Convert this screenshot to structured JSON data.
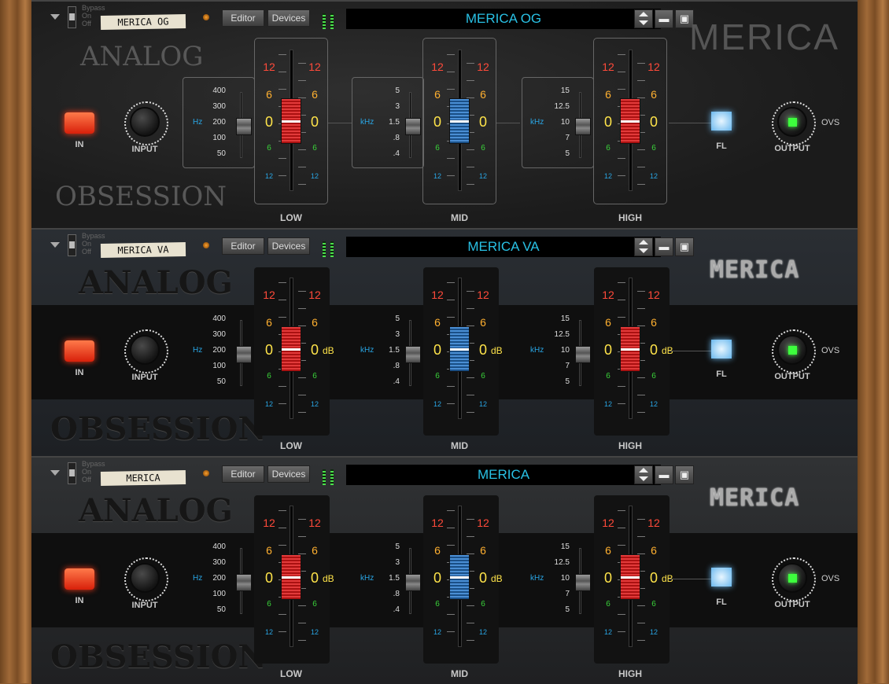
{
  "units": [
    {
      "style": "og",
      "header": {
        "bypass": "Bypass",
        "on": "On",
        "off": "Off",
        "name_label": "MERICA OG",
        "editor": "Editor",
        "devices": "Devices",
        "preset": "MERICA OG"
      },
      "brand": "MERICA",
      "deco_top": "ANALOG",
      "deco_bottom": "OBSESSION",
      "show_db": false,
      "boxed": true
    },
    {
      "style": "va",
      "header": {
        "bypass": "Bypass",
        "on": "On",
        "off": "Off",
        "name_label": "MERICA VA",
        "editor": "Editor",
        "devices": "Devices",
        "preset": "MERICA VA"
      },
      "brand": "MERICA",
      "deco_top": "ANALOG",
      "deco_bottom": "OBSESSION",
      "show_db": true,
      "boxed": false
    },
    {
      "style": "m",
      "header": {
        "bypass": "Bypass",
        "on": "On",
        "off": "Off",
        "name_label": "MERICA",
        "editor": "Editor",
        "devices": "Devices",
        "preset": "MERICA"
      },
      "brand": "MERICA",
      "deco_top": "ANALOG",
      "deco_bottom": "OBSESSION",
      "show_db": true,
      "boxed": false
    }
  ],
  "common": {
    "in_label": "IN",
    "input_label": "INPUT",
    "output_label": "OUTPUT",
    "fl_label": "FL",
    "ovs_label": "OVS",
    "db_unit": "dB",
    "bands": [
      {
        "name": "LOW",
        "unit": "Hz",
        "freqs": [
          "400",
          "300",
          "200",
          "100",
          "50"
        ],
        "color": "red"
      },
      {
        "name": "MID",
        "unit": "kHz",
        "freqs": [
          "5",
          "3",
          "1.5",
          ".8",
          ".4"
        ],
        "color": "blue"
      },
      {
        "name": "HIGH",
        "unit": "kHz",
        "freqs": [
          "15",
          "12.5",
          "10",
          "7",
          "5"
        ],
        "color": "red"
      }
    ],
    "gain_scale": {
      "top": "12",
      "upper": "6",
      "center": "0",
      "lower": "6",
      "bottom": "12"
    },
    "gain_values": {
      "low": 0,
      "mid": 0,
      "high": 0
    },
    "colors": {
      "preset_text": "#29c1e5",
      "gain_top": "#ff4a3a",
      "gain_six": "#ffb030",
      "gain_zero": "#ffe44a",
      "gain_lower": "#3ad43a",
      "gain_bottom": "#29a6e5",
      "in_led": "#ff4a2a",
      "fl_led": "#8ccaf2",
      "ovs_led": "#3dff3d"
    },
    "icons": [
      "collapse-arrow-icon",
      "power-led-icon",
      "preset-arrows-icon",
      "folder-icon",
      "save-icon",
      "level-meter-icon"
    ]
  }
}
